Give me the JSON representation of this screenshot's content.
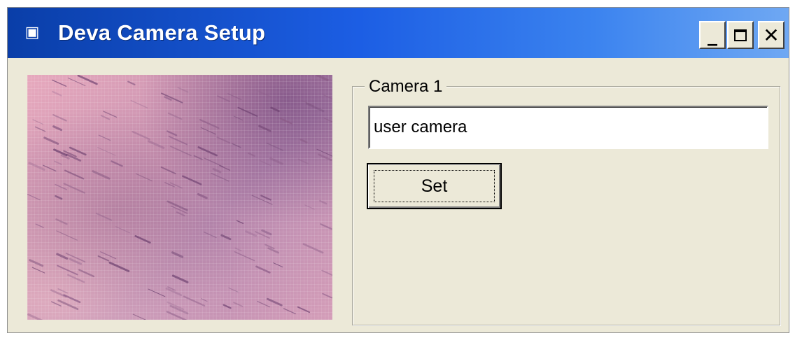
{
  "window": {
    "title": "Deva Camera Setup",
    "app_icon": "window-app-icon",
    "controls": {
      "minimize": "_",
      "close": "✕"
    }
  },
  "camera_group": {
    "label": "Camera 1",
    "name_field_value": "user camera",
    "set_button_label": "Set"
  },
  "picture": {
    "content": "pink-purple textured image"
  },
  "colors": {
    "titlebar_start": "#0a3ea8",
    "titlebar_end": "#6fa8f3",
    "dialog_background": "#ece9d8"
  }
}
